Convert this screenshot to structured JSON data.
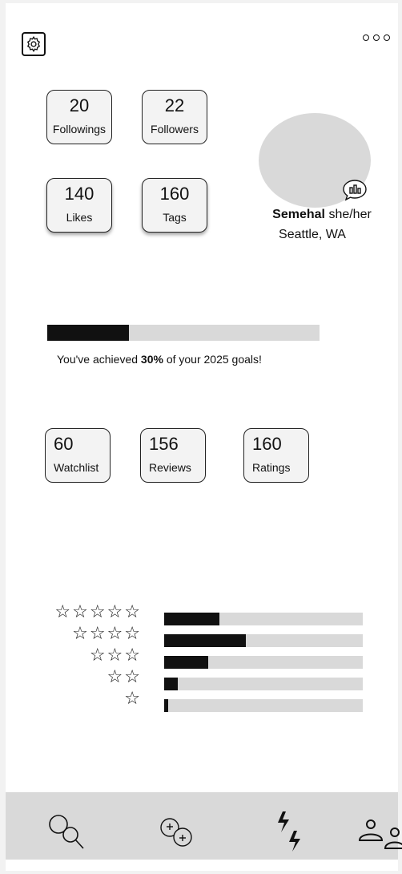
{
  "header": {
    "settings_icon": "gear-icon",
    "more_icon": "more-dots-icon"
  },
  "stats_top": [
    {
      "value": "20",
      "label": "Followings"
    },
    {
      "value": "22",
      "label": "Followers"
    },
    {
      "value": "140",
      "label": "Likes"
    },
    {
      "value": "160",
      "label": "Tags"
    }
  ],
  "profile": {
    "name": "Semehal",
    "pronouns": "she/her",
    "location": "Seattle, WA",
    "badge_icon": "chart-bubble-icon"
  },
  "goal": {
    "progress": 0.3,
    "text_before": "You've achieved ",
    "percent": "30%",
    "text_after": " of your 2025 goals!"
  },
  "stats_bottom": [
    {
      "value": "60",
      "label": "Watchlist"
    },
    {
      "value": "156",
      "label": "Reviews"
    },
    {
      "value": "160",
      "label": "Ratings"
    }
  ],
  "ratings": [
    {
      "stars": "☆☆☆☆☆",
      "fraction": 0.28
    },
    {
      "stars": "☆☆☆☆",
      "fraction": 0.41
    },
    {
      "stars": "☆☆☆",
      "fraction": 0.22
    },
    {
      "stars": "☆☆",
      "fraction": 0.07
    },
    {
      "stars": "☆",
      "fraction": 0.02
    }
  ],
  "tabbar": {
    "items": [
      "search-icon",
      "add-icon",
      "activity-icon",
      "people-icon"
    ]
  },
  "colors": {
    "accent": "#111111",
    "track": "#d9d9d9",
    "card_bg": "#f3f3f3"
  }
}
